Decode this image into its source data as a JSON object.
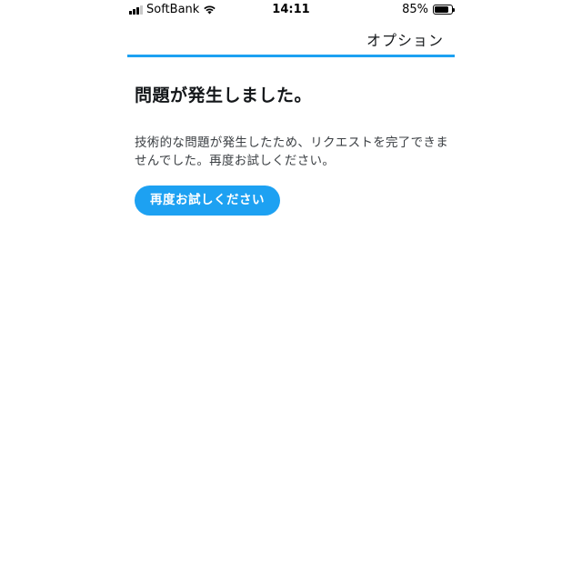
{
  "status_bar": {
    "carrier": "SoftBank",
    "time": "14:11",
    "battery_percent": "85%",
    "battery_level": 0.85,
    "signal_bars": 3
  },
  "nav": {
    "option_label": "オプション",
    "accent_color": "#1da1f2"
  },
  "error": {
    "title": "問題が発生しました。",
    "message_line1": "技術的な問題が発生したため、リクエストを完了できま",
    "message_line2": "せんでした。再度お試しください。",
    "retry_label": "再度お試しください"
  }
}
